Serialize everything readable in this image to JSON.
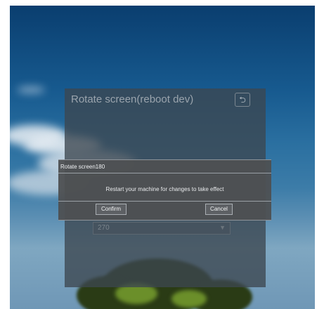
{
  "settings_panel": {
    "title": "Rotate screen(reboot dev)",
    "back_icon": "return-icon",
    "rotation_select": {
      "value": "270",
      "caret_icon": "chevron-down-icon"
    }
  },
  "dialog": {
    "title": "Rotate screen180",
    "message": "Restart your machine for changes to take effect",
    "confirm_label": "Confirm",
    "cancel_label": "Cancel"
  }
}
